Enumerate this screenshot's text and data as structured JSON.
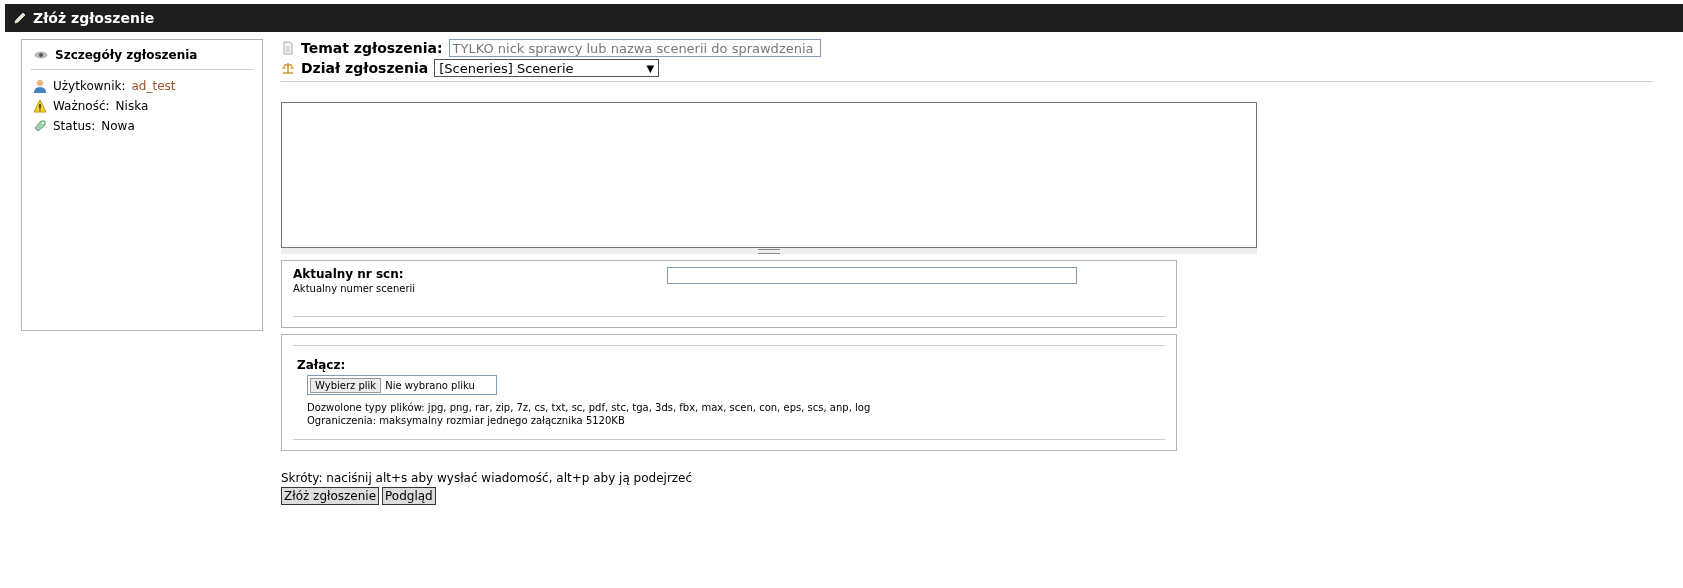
{
  "header": {
    "title": "Złóż zgłoszenie"
  },
  "sidebar": {
    "title": "Szczegóły zgłoszenia",
    "items": [
      {
        "kind": "user",
        "label": "Użytkownik:",
        "value": "ad_test",
        "link": true
      },
      {
        "kind": "warning",
        "label": "Ważność:",
        "value": "Niska",
        "link": false
      },
      {
        "kind": "status",
        "label": "Status:",
        "value": "Nowa",
        "link": false
      }
    ]
  },
  "subject": {
    "label": "Temat zgłoszenia:",
    "placeholder": "TYLKO nick sprawcy lub nazwa scenerii do sprawdzenia"
  },
  "category": {
    "label": "Dział zgłoszenia",
    "value": "[Sceneries] Scenerie",
    "arrow": "▼"
  },
  "custom_fields": [
    {
      "label": "Aktualny nr scn:",
      "description": "Aktualny numer scenerii"
    }
  ],
  "attachment": {
    "label": "Załącz:",
    "button": "Wybierz plik",
    "file_status": "Nie wybrano pliku",
    "allowed": "Dozwolone typy plików: jpg, png, rar, zip, 7z, cs, txt, sc, pdf, stc, tga, 3ds, fbx, max, scen, con, eps, scs, anp, log",
    "limits": "Ograniczenia: maksymalny rozmiar jednego załącznika 5120KB"
  },
  "shortcuts": "Skróty: naciśnij alt+s aby wysłać wiadomość, alt+p aby ją podejrzeć",
  "buttons": [
    {
      "label": "Złóż zgłoszenie"
    },
    {
      "label": "Podgląd"
    }
  ]
}
